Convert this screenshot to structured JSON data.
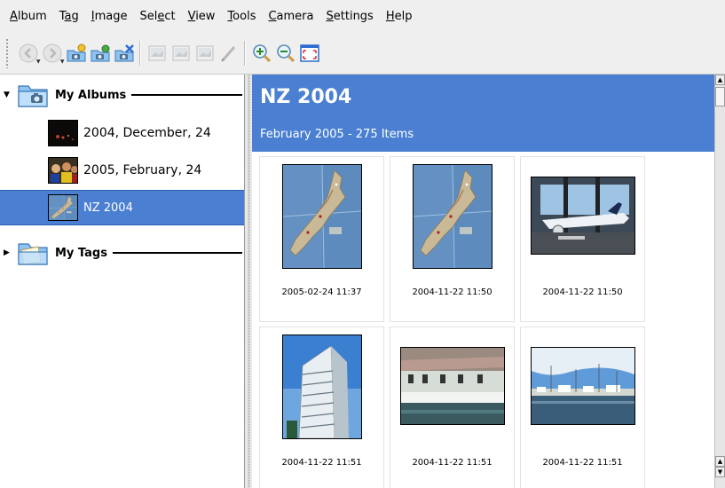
{
  "menu": [
    {
      "label": "Album",
      "name": "menu-album"
    },
    {
      "label": "Tag",
      "name": "menu-tag"
    },
    {
      "label": "Image",
      "name": "menu-image"
    },
    {
      "label": "Select",
      "name": "menu-select"
    },
    {
      "label": "View",
      "name": "menu-view"
    },
    {
      "label": "Tools",
      "name": "menu-tools"
    },
    {
      "label": "Camera",
      "name": "menu-camera"
    },
    {
      "label": "Settings",
      "name": "menu-settings"
    },
    {
      "label": "Help",
      "name": "menu-help"
    }
  ],
  "toolbar": [
    {
      "icon": "back-icon",
      "disabled": true
    },
    {
      "icon": "forward-icon",
      "disabled": true
    },
    {
      "icon": "new-album-icon"
    },
    {
      "icon": "album-properties-icon"
    },
    {
      "icon": "delete-album-icon"
    },
    {
      "icon": "separator"
    },
    {
      "icon": "view-image-icon",
      "disabled": true
    },
    {
      "icon": "edit-image-icon",
      "disabled": true
    },
    {
      "icon": "delete-image-icon",
      "disabled": true
    },
    {
      "icon": "comment-icon",
      "disabled": true
    },
    {
      "icon": "separator"
    },
    {
      "icon": "zoom-in-icon"
    },
    {
      "icon": "zoom-out-icon"
    },
    {
      "icon": "fullscreen-icon"
    }
  ],
  "tree": {
    "albums_label": "My Albums",
    "tags_label": "My Tags",
    "albums": [
      {
        "label": "2004, December, 24",
        "selected": false,
        "thumb": "night"
      },
      {
        "label": "2005, February, 24",
        "selected": false,
        "thumb": "party"
      },
      {
        "label": "NZ 2004",
        "selected": true,
        "thumb": "map"
      }
    ]
  },
  "album": {
    "title": "NZ 2004",
    "subtitle": "February 2005 - 275 Items",
    "items": [
      {
        "caption": "2005-02-24 11:37",
        "kind": "map",
        "orient": "portrait"
      },
      {
        "caption": "2004-11-22 11:50",
        "kind": "map",
        "orient": "portrait"
      },
      {
        "caption": "2004-11-22 11:50",
        "kind": "plane",
        "orient": "landscape"
      },
      {
        "caption": "2004-11-22 11:51",
        "kind": "building",
        "orient": "portrait"
      },
      {
        "caption": "2004-11-22 11:51",
        "kind": "boat",
        "orient": "landscape"
      },
      {
        "caption": "2004-11-22 11:51",
        "kind": "harbor",
        "orient": "landscape"
      }
    ]
  },
  "colors": {
    "selection": "#4a7fd2",
    "banner": "#4a7fd2"
  }
}
